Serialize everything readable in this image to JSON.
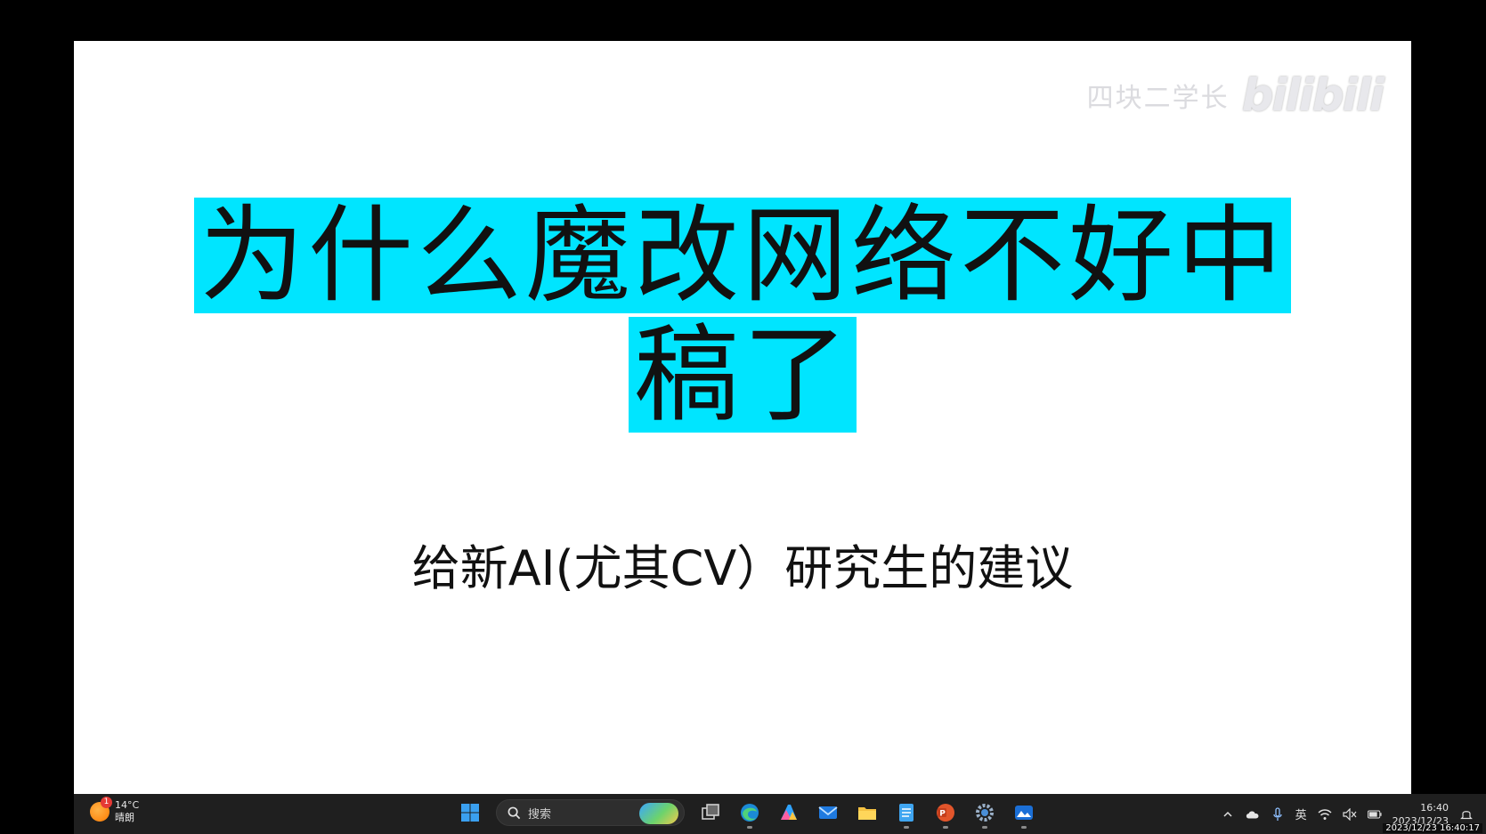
{
  "slide": {
    "title_line1": "为什么魔改网络不好中",
    "title_line2": "稿了",
    "subtitle": "给新AI(尤其CV）研究生的建议",
    "highlight_color": "#00e5ff"
  },
  "watermark": {
    "channel": "四块二学长",
    "logo": "bilibili"
  },
  "taskbar": {
    "weather": {
      "badge": "1",
      "temperature": "14°C",
      "condition": "晴朗"
    },
    "search": {
      "label": "搜索"
    },
    "apps": [
      {
        "icon": "windows-start-icon"
      },
      {
        "icon": "task-view-icon"
      },
      {
        "icon": "edge-browser-icon"
      },
      {
        "icon": "copilot-icon"
      },
      {
        "icon": "mail-icon"
      },
      {
        "icon": "file-explorer-icon"
      },
      {
        "icon": "notepad-icon"
      },
      {
        "icon": "powerpoint-icon"
      },
      {
        "icon": "settings-gear-icon"
      },
      {
        "icon": "photos-icon"
      }
    ],
    "tray": {
      "ime": "英",
      "time": "16:40",
      "date": "2023/12/23"
    },
    "overlay_timestamp": "2023/12/23 16:40:17"
  }
}
